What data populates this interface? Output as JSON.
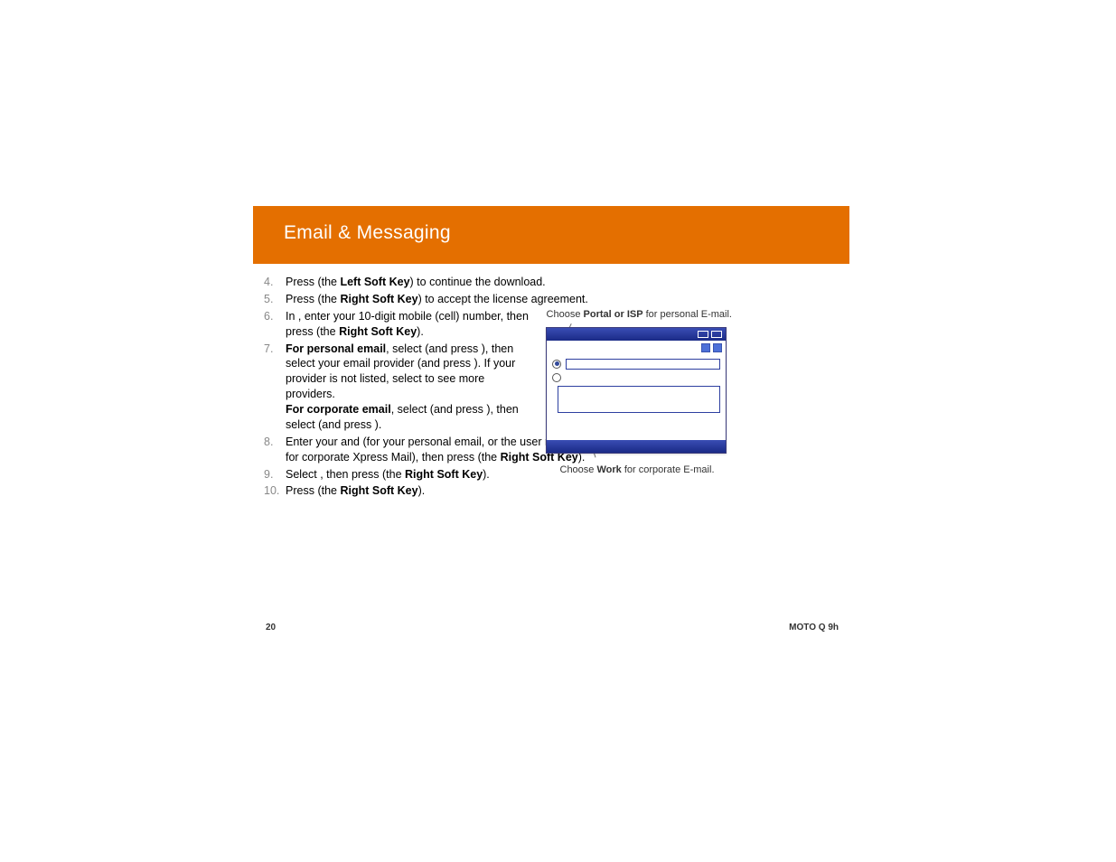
{
  "header_title": "Email & Messaging",
  "steps": {
    "s4": {
      "num": "4.",
      "t1": "Press ",
      "key1": "Left Soft Key",
      "t2": ") to continue the download."
    },
    "s5": {
      "num": "5.",
      "t1": "Press ",
      "key1": "Right Soft Key",
      "t2": ") to accept the license agreement."
    },
    "s6": {
      "num": "6.",
      "t1": "In ",
      "t2": ", enter your 10-digit mobile (cell) number, then press ",
      "t3": "(the ",
      "key1": "Right Soft Key",
      "t4": ")."
    },
    "s7": {
      "num": "7.",
      "b1": "For personal email",
      "t1": ", select ",
      "t2": "(and press ",
      "t3": "), then select your email provider (and press ",
      "t4": "). If your provider is not listed, select ",
      "t5": " to see more providers.",
      "b2": "For corporate email",
      "t6": ", select ",
      "t7": " (and press ",
      "t8": "), then select ",
      "t9": "(and press ",
      "t10": ")."
    },
    "s8": {
      "num": "8.",
      "t1": "Enter your ",
      "t2": " and ",
      "t3": " (for your personal email, or the user name and password you created for corporate Xpress Mail), then press ",
      "t4": " (the ",
      "key1": "Right Soft Key",
      "t5": ")."
    },
    "s9": {
      "num": "9.",
      "t1": "Select ",
      "t2": ", then press ",
      "t3": " (the ",
      "key1": "Right Soft Key",
      "t4": ")."
    },
    "s10": {
      "num": "10.",
      "t1": "Press ",
      "t2": " (the ",
      "key1": "Right Soft Key",
      "t3": ")."
    }
  },
  "callouts": {
    "top_pre": "Choose ",
    "top_bold": "Portal or ISP",
    "top_post": " for personal E-mail.",
    "bottom_pre": "Choose ",
    "bottom_bold": "Work",
    "bottom_post": " for corporate E-mail."
  },
  "footer": {
    "page": "20",
    "device": "MOTO Q 9h"
  }
}
